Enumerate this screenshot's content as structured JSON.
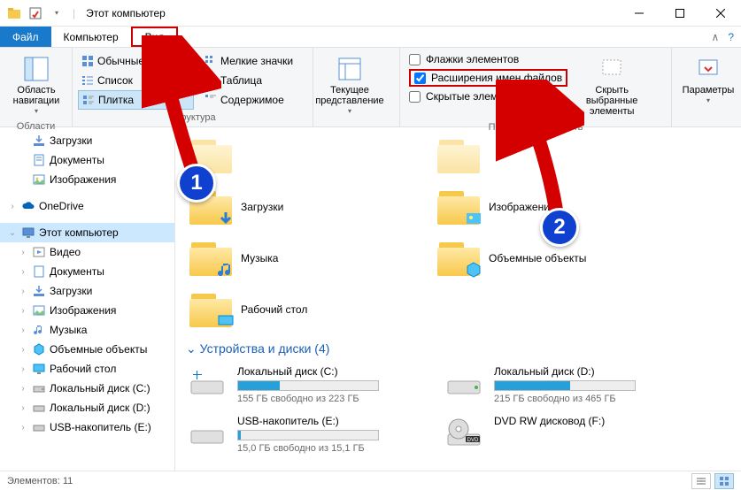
{
  "window": {
    "title": "Этот компьютер"
  },
  "tabs": {
    "file": "Файл",
    "computer": "Компьютер",
    "view": "Вид"
  },
  "ribbon": {
    "nav_pane": "Область навигации",
    "nav_group": "Области",
    "layout": {
      "normal_icons": "Обычные значки",
      "small_icons": "Мелкие значки",
      "list": "Список",
      "table": "Таблица",
      "tiles": "Плитка",
      "content": "Содержимое",
      "group": "Структура"
    },
    "current_view": "Текущее представление",
    "checks": {
      "item_flags": "Флажки элементов",
      "file_ext": "Расширения имен файлов",
      "hidden": "Скрытые элементы"
    },
    "hide_selected": "Скрыть выбранные элементы",
    "show_hide_group": "Показать или скрыть",
    "options": "Параметры"
  },
  "nav": {
    "downloads": "Загрузки",
    "documents": "Документы",
    "pictures": "Изображения",
    "onedrive": "OneDrive",
    "this_pc": "Этот компьютер",
    "videos": "Видео",
    "music": "Музыка",
    "objects3d": "Объемные объекты",
    "desktop": "Рабочий стол",
    "drive_c": "Локальный диск (C:)",
    "drive_d": "Локальный диск (D:)",
    "drive_e": "USB-накопитель (E:)"
  },
  "content": {
    "folders": {
      "downloads": "Загрузки",
      "pictures": "Изображения",
      "music": "Музыка",
      "objects3d": "Объемные объекты",
      "desktop": "Рабочий стол"
    },
    "drives_header": "Устройства и диски (4)",
    "drives": {
      "c": {
        "name": "Локальный диск (C:)",
        "sub": "155 ГБ свободно из 223 ГБ",
        "fill": 30
      },
      "d": {
        "name": "Локальный диск (D:)",
        "sub": "215 ГБ свободно из 465 ГБ",
        "fill": 54
      },
      "e": {
        "name": "USB-накопитель (E:)",
        "sub": "15,0 ГБ свободно из 15,1 ГБ",
        "fill": 2
      },
      "f": {
        "name": "DVD RW дисковод (F:)"
      }
    }
  },
  "status": {
    "count": "Элементов: 11"
  },
  "annotations": {
    "one": "1",
    "two": "2"
  }
}
